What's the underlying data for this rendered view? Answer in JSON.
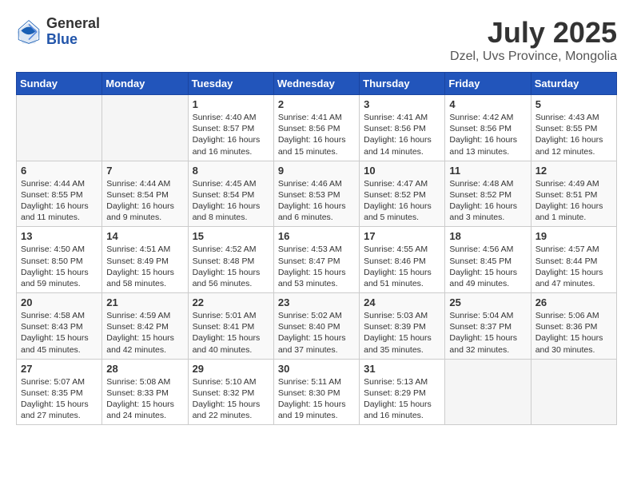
{
  "logo": {
    "general": "General",
    "blue": "Blue"
  },
  "header": {
    "month_year": "July 2025",
    "location": "Dzel, Uvs Province, Mongolia"
  },
  "weekdays": [
    "Sunday",
    "Monday",
    "Tuesday",
    "Wednesday",
    "Thursday",
    "Friday",
    "Saturday"
  ],
  "weeks": [
    [
      {
        "day": "",
        "sunrise": "",
        "sunset": "",
        "daylight": ""
      },
      {
        "day": "",
        "sunrise": "",
        "sunset": "",
        "daylight": ""
      },
      {
        "day": "1",
        "sunrise": "Sunrise: 4:40 AM",
        "sunset": "Sunset: 8:57 PM",
        "daylight": "Daylight: 16 hours and 16 minutes."
      },
      {
        "day": "2",
        "sunrise": "Sunrise: 4:41 AM",
        "sunset": "Sunset: 8:56 PM",
        "daylight": "Daylight: 16 hours and 15 minutes."
      },
      {
        "day": "3",
        "sunrise": "Sunrise: 4:41 AM",
        "sunset": "Sunset: 8:56 PM",
        "daylight": "Daylight: 16 hours and 14 minutes."
      },
      {
        "day": "4",
        "sunrise": "Sunrise: 4:42 AM",
        "sunset": "Sunset: 8:56 PM",
        "daylight": "Daylight: 16 hours and 13 minutes."
      },
      {
        "day": "5",
        "sunrise": "Sunrise: 4:43 AM",
        "sunset": "Sunset: 8:55 PM",
        "daylight": "Daylight: 16 hours and 12 minutes."
      }
    ],
    [
      {
        "day": "6",
        "sunrise": "Sunrise: 4:44 AM",
        "sunset": "Sunset: 8:55 PM",
        "daylight": "Daylight: 16 hours and 11 minutes."
      },
      {
        "day": "7",
        "sunrise": "Sunrise: 4:44 AM",
        "sunset": "Sunset: 8:54 PM",
        "daylight": "Daylight: 16 hours and 9 minutes."
      },
      {
        "day": "8",
        "sunrise": "Sunrise: 4:45 AM",
        "sunset": "Sunset: 8:54 PM",
        "daylight": "Daylight: 16 hours and 8 minutes."
      },
      {
        "day": "9",
        "sunrise": "Sunrise: 4:46 AM",
        "sunset": "Sunset: 8:53 PM",
        "daylight": "Daylight: 16 hours and 6 minutes."
      },
      {
        "day": "10",
        "sunrise": "Sunrise: 4:47 AM",
        "sunset": "Sunset: 8:52 PM",
        "daylight": "Daylight: 16 hours and 5 minutes."
      },
      {
        "day": "11",
        "sunrise": "Sunrise: 4:48 AM",
        "sunset": "Sunset: 8:52 PM",
        "daylight": "Daylight: 16 hours and 3 minutes."
      },
      {
        "day": "12",
        "sunrise": "Sunrise: 4:49 AM",
        "sunset": "Sunset: 8:51 PM",
        "daylight": "Daylight: 16 hours and 1 minute."
      }
    ],
    [
      {
        "day": "13",
        "sunrise": "Sunrise: 4:50 AM",
        "sunset": "Sunset: 8:50 PM",
        "daylight": "Daylight: 15 hours and 59 minutes."
      },
      {
        "day": "14",
        "sunrise": "Sunrise: 4:51 AM",
        "sunset": "Sunset: 8:49 PM",
        "daylight": "Daylight: 15 hours and 58 minutes."
      },
      {
        "day": "15",
        "sunrise": "Sunrise: 4:52 AM",
        "sunset": "Sunset: 8:48 PM",
        "daylight": "Daylight: 15 hours and 56 minutes."
      },
      {
        "day": "16",
        "sunrise": "Sunrise: 4:53 AM",
        "sunset": "Sunset: 8:47 PM",
        "daylight": "Daylight: 15 hours and 53 minutes."
      },
      {
        "day": "17",
        "sunrise": "Sunrise: 4:55 AM",
        "sunset": "Sunset: 8:46 PM",
        "daylight": "Daylight: 15 hours and 51 minutes."
      },
      {
        "day": "18",
        "sunrise": "Sunrise: 4:56 AM",
        "sunset": "Sunset: 8:45 PM",
        "daylight": "Daylight: 15 hours and 49 minutes."
      },
      {
        "day": "19",
        "sunrise": "Sunrise: 4:57 AM",
        "sunset": "Sunset: 8:44 PM",
        "daylight": "Daylight: 15 hours and 47 minutes."
      }
    ],
    [
      {
        "day": "20",
        "sunrise": "Sunrise: 4:58 AM",
        "sunset": "Sunset: 8:43 PM",
        "daylight": "Daylight: 15 hours and 45 minutes."
      },
      {
        "day": "21",
        "sunrise": "Sunrise: 4:59 AM",
        "sunset": "Sunset: 8:42 PM",
        "daylight": "Daylight: 15 hours and 42 minutes."
      },
      {
        "day": "22",
        "sunrise": "Sunrise: 5:01 AM",
        "sunset": "Sunset: 8:41 PM",
        "daylight": "Daylight: 15 hours and 40 minutes."
      },
      {
        "day": "23",
        "sunrise": "Sunrise: 5:02 AM",
        "sunset": "Sunset: 8:40 PM",
        "daylight": "Daylight: 15 hours and 37 minutes."
      },
      {
        "day": "24",
        "sunrise": "Sunrise: 5:03 AM",
        "sunset": "Sunset: 8:39 PM",
        "daylight": "Daylight: 15 hours and 35 minutes."
      },
      {
        "day": "25",
        "sunrise": "Sunrise: 5:04 AM",
        "sunset": "Sunset: 8:37 PM",
        "daylight": "Daylight: 15 hours and 32 minutes."
      },
      {
        "day": "26",
        "sunrise": "Sunrise: 5:06 AM",
        "sunset": "Sunset: 8:36 PM",
        "daylight": "Daylight: 15 hours and 30 minutes."
      }
    ],
    [
      {
        "day": "27",
        "sunrise": "Sunrise: 5:07 AM",
        "sunset": "Sunset: 8:35 PM",
        "daylight": "Daylight: 15 hours and 27 minutes."
      },
      {
        "day": "28",
        "sunrise": "Sunrise: 5:08 AM",
        "sunset": "Sunset: 8:33 PM",
        "daylight": "Daylight: 15 hours and 24 minutes."
      },
      {
        "day": "29",
        "sunrise": "Sunrise: 5:10 AM",
        "sunset": "Sunset: 8:32 PM",
        "daylight": "Daylight: 15 hours and 22 minutes."
      },
      {
        "day": "30",
        "sunrise": "Sunrise: 5:11 AM",
        "sunset": "Sunset: 8:30 PM",
        "daylight": "Daylight: 15 hours and 19 minutes."
      },
      {
        "day": "31",
        "sunrise": "Sunrise: 5:13 AM",
        "sunset": "Sunset: 8:29 PM",
        "daylight": "Daylight: 15 hours and 16 minutes."
      },
      {
        "day": "",
        "sunrise": "",
        "sunset": "",
        "daylight": ""
      },
      {
        "day": "",
        "sunrise": "",
        "sunset": "",
        "daylight": ""
      }
    ]
  ]
}
